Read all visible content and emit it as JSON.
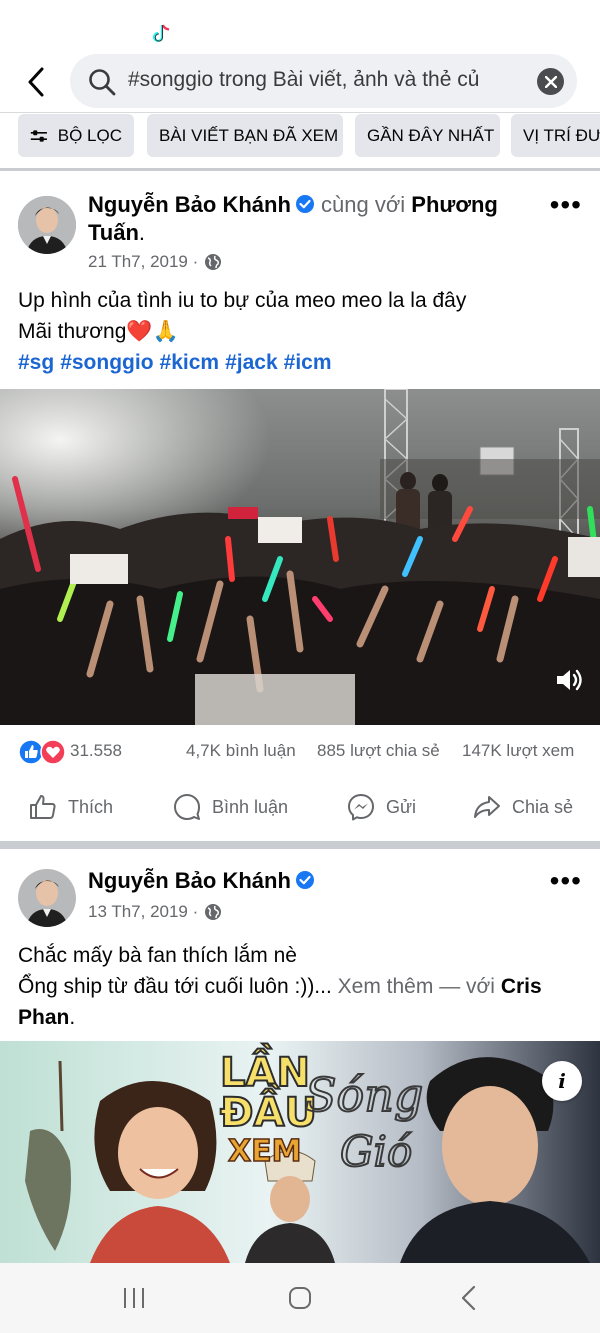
{
  "search": {
    "query": "#songgio trong Bài viết, ảnh và thẻ củ"
  },
  "filters": [
    {
      "label": "BỘ LỌC"
    },
    {
      "label": "BÀI VIẾT BẠN ĐÃ XEM"
    },
    {
      "label": "GẦN ĐÂY NHẤT"
    },
    {
      "label": "VỊ TRÍ ĐƯỢ"
    }
  ],
  "posts": [
    {
      "author": "Nguyễn Bảo Khánh",
      "with_text": "cùng với",
      "tagged": "Phương Tuấn",
      "date": "21 Th7, 2019 ·",
      "text_line1": "Up hình của tình iu to bự của meo meo la la đây",
      "text_line2": "Mãi thương❤️🙏",
      "hashtags": [
        "#sg",
        "#songgio",
        "#kicm",
        "#jack",
        "#icm"
      ],
      "reactions_count": "31.558",
      "comments": "4,7K bình luận",
      "shares": "885 lượt chia sẻ",
      "views": "147K lượt xem"
    },
    {
      "author": "Nguyễn Bảo Khánh",
      "date": "13 Th7, 2019 ·",
      "text_line1": "Chắc mấy bà fan thích lắm nè",
      "text_line2": "Ổng ship từ đầu tới cuối luôn :))...",
      "see_more": "Xem thêm",
      "with_text": "— với",
      "tagged": "Cris Phan",
      "thumb_title1": "LẦN",
      "thumb_title2": "ĐẦU",
      "thumb_title3": "XEM",
      "thumb_script1": "Sóng",
      "thumb_script2": "Gió"
    }
  ],
  "actions": {
    "like": "Thích",
    "comment": "Bình luận",
    "send": "Gửi",
    "share": "Chia sẻ"
  },
  "colors": {
    "accent": "#1b66d2",
    "verified": "#1877f2",
    "secondary_text": "#65676b"
  }
}
